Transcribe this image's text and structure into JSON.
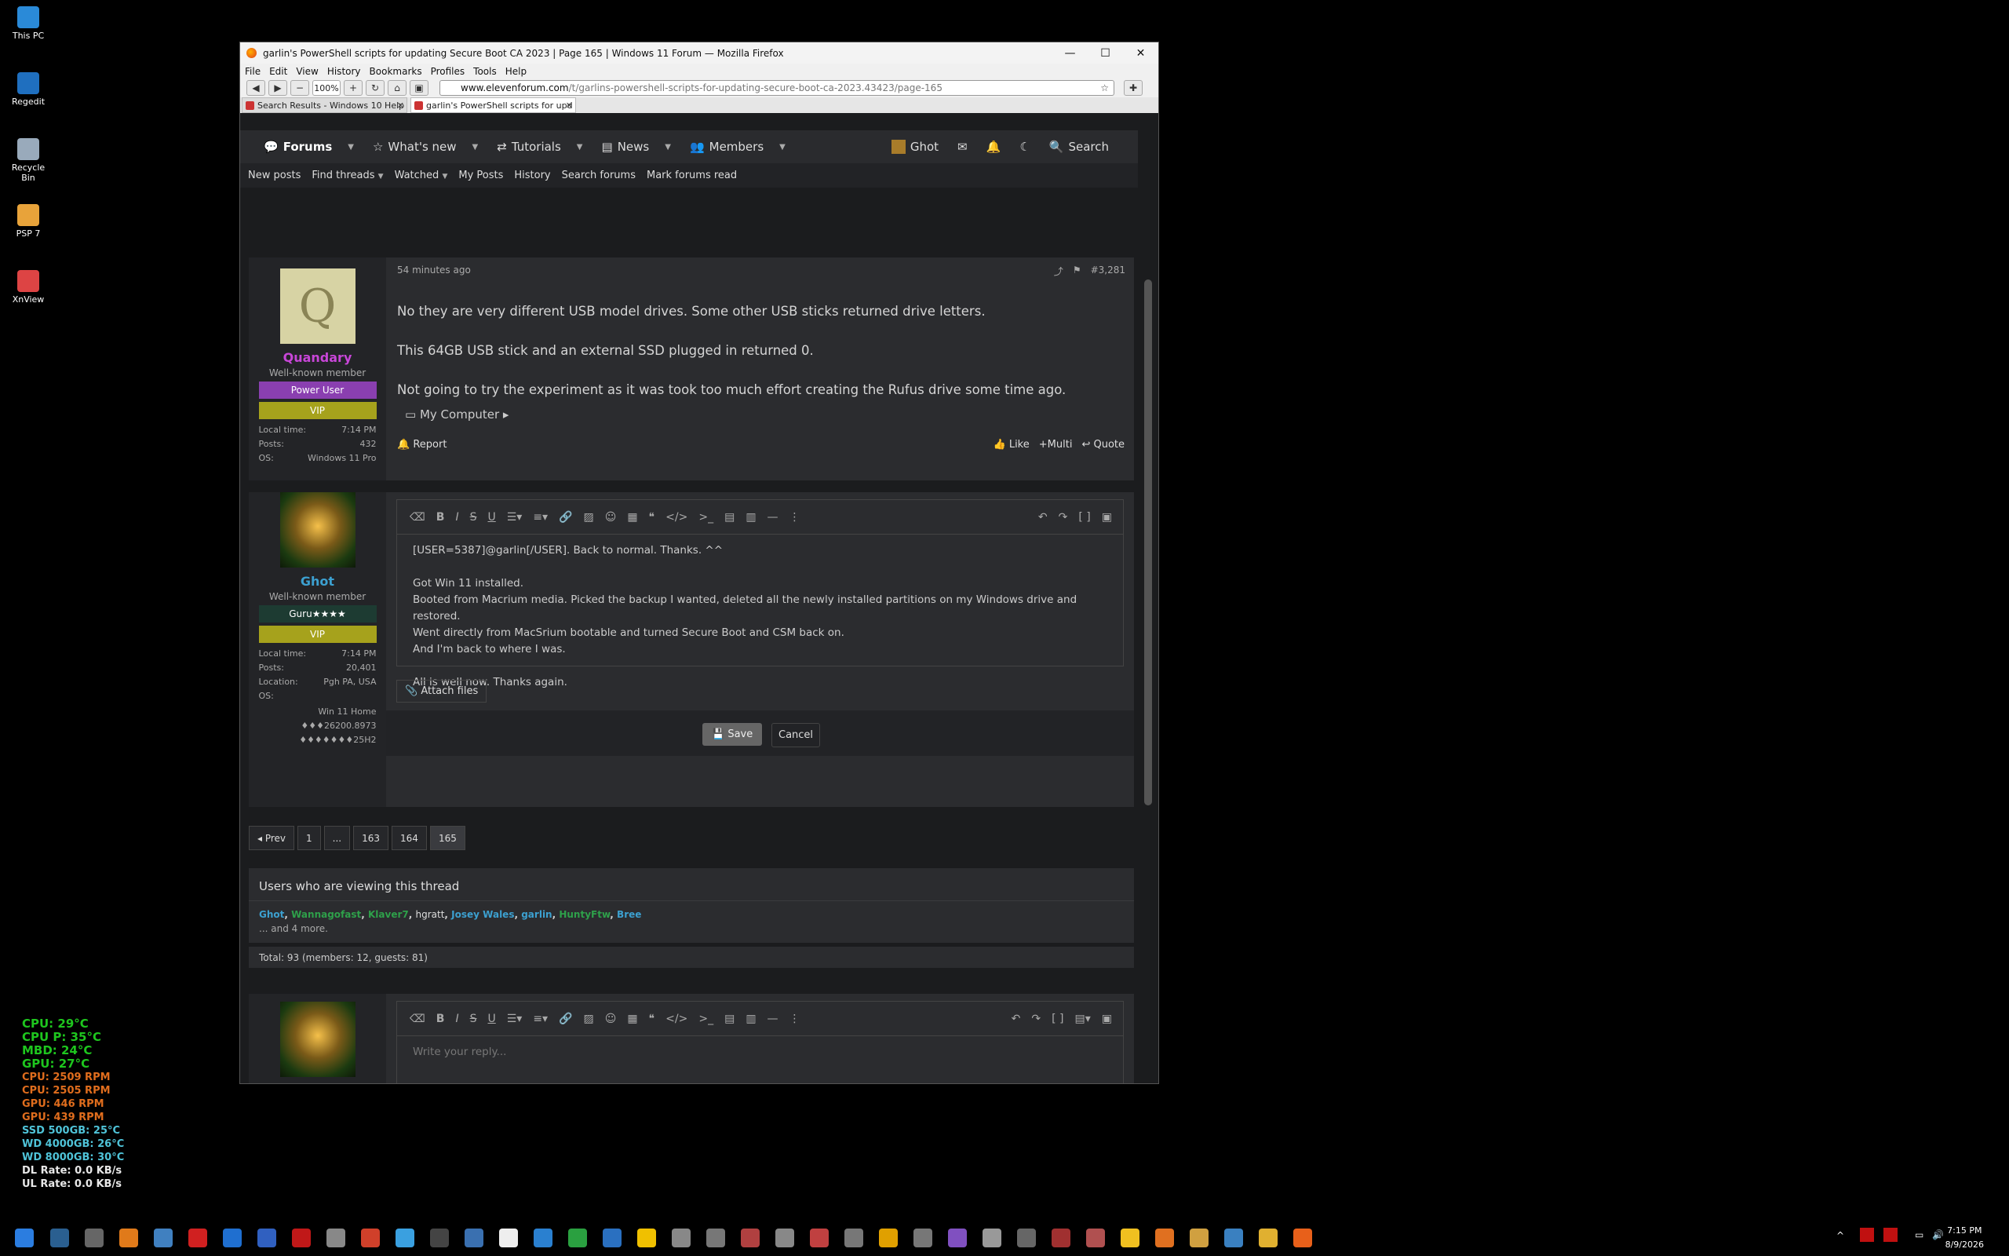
{
  "desktop": {
    "icons": [
      "This PC",
      "Regedit",
      "Recycle Bin",
      "PSP 7",
      "XnView"
    ]
  },
  "sensors": {
    "green": [
      "CPU: 29°C",
      "CPU P: 35°C",
      "MBD: 24°C",
      "GPU: 27°C"
    ],
    "orange": [
      "CPU: 2509 RPM",
      "CPU: 2505 RPM",
      "GPU: 446 RPM",
      "GPU: 439 RPM"
    ],
    "cyan": [
      "SSD 500GB: 25°C",
      "WD 4000GB: 26°C",
      "WD 8000GB: 30°C"
    ],
    "white": [
      "DL Rate: 0.0 KB/s",
      "UL Rate: 0.0 KB/s"
    ]
  },
  "window": {
    "title": "garlin's PowerShell scripts for updating Secure Boot CA 2023 | Page 165 | Windows 11 Forum — Mozilla Firefox",
    "minimize": "—",
    "maximize": "☐",
    "close": "✕"
  },
  "menu": [
    "File",
    "Edit",
    "View",
    "History",
    "Bookmarks",
    "Profiles",
    "Tools",
    "Help"
  ],
  "toolbar": {
    "zoom": "100%",
    "url_domain": "www.elevenforum.com",
    "url_path": "/t/garlins-powershell-scripts-for-updating-secure-boot-ca-2023.43423/page-165"
  },
  "tabs": [
    {
      "label": "Search Results - Windows 10 Help"
    },
    {
      "label": "garlin's PowerShell scripts for upd"
    }
  ],
  "nav": {
    "items": [
      "Forums",
      "What's new",
      "Tutorials",
      "News",
      "Members"
    ],
    "user": "Ghot",
    "search": "Search"
  },
  "subnav": [
    "New posts",
    "Find threads",
    "Watched",
    "My Posts",
    "History",
    "Search forums",
    "Mark forums read"
  ],
  "post1": {
    "avatar_letter": "Q",
    "username": "Quandary",
    "title": "Well-known member",
    "rank": "Power User",
    "vip": "VIP",
    "stats": [
      [
        "Local time:",
        "7:14 PM"
      ],
      [
        "Posts:",
        "432"
      ],
      [
        "OS:",
        "Windows 11 Pro"
      ]
    ],
    "time": "54 minutes ago",
    "number": "#3,281",
    "lines": [
      "No they are very different USB model drives. Some other USB sticks returned drive letters.",
      "This 64GB USB stick and an external SSD plugged in returned 0.",
      "Not going to try the experiment as it was took too much effort creating the Rufus drive some time ago."
    ],
    "mycomputer": "My Computer",
    "report": "Report",
    "like": "Like",
    "multi": "Multi",
    "quote": "Quote"
  },
  "post2": {
    "username": "Ghot",
    "title": "Well-known member",
    "rank": "Guru★★★★",
    "vip": "VIP",
    "stats": [
      [
        "Local time:",
        "7:14 PM"
      ],
      [
        "Posts:",
        "20,401"
      ],
      [
        "Location:",
        "Pgh PA, USA"
      ],
      [
        "OS:",
        ""
      ]
    ],
    "os_lines": [
      "Win 11 Home",
      "♦♦♦26200.8973",
      "♦♦♦♦♦♦♦25H2"
    ],
    "editor_lines": [
      "[USER=5387]@garlin[/USER].   Back to normal.  Thanks.  ^^",
      "",
      "Got Win 11 installed.",
      "Booted from Macrium media.  Picked the backup I wanted, deleted all the newly installed partitions on my Windows drive and",
      "restored.",
      "Went directly from MacSrium bootable and turned Secure Boot and CSM back on.",
      "And I'm back to where I was.",
      "",
      "All is well now.  Thanks again."
    ],
    "attach": "Attach files",
    "save": "Save",
    "cancel": "Cancel"
  },
  "pager": {
    "prev": "◂ Prev",
    "pages": [
      "1",
      "...",
      "163",
      "164",
      "165"
    ]
  },
  "viewing": {
    "title": "Users who are viewing this thread",
    "users": [
      {
        "name": "Ghot",
        "color": "#3ca0d0"
      },
      {
        "name": "Wannagofast",
        "color": "#2ea04a"
      },
      {
        "name": "Klaver7",
        "color": "#2ea04a"
      },
      {
        "name": "hgratt",
        "color": "#dddddd"
      },
      {
        "name": "Josey Wales",
        "color": "#3ca0d0"
      },
      {
        "name": "garlin",
        "color": "#3ca0d0"
      },
      {
        "name": "HuntyFtw",
        "color": "#2ea04a"
      },
      {
        "name": "Bree",
        "color": "#3ca0d0"
      }
    ],
    "more": "... and 4 more.",
    "total": "Total: 93 (members: 12, guests: 81)"
  },
  "reply": {
    "placeholder": "Write your reply..."
  },
  "clock": {
    "time": "7:15 PM",
    "date": "8/9/2026"
  }
}
